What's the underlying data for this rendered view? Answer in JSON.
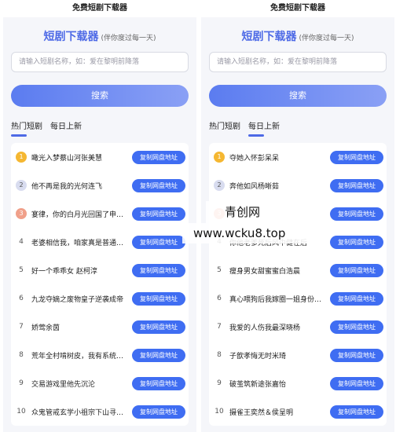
{
  "left": {
    "status_title": "免费短剧下载器",
    "app_name": "短剧下载器",
    "app_sub": "(伴你度过每一天)",
    "search_placeholder": "请输入短剧名称，如：爱在黎明前降落",
    "search_label": "搜索",
    "tabs": [
      "热门短剧",
      "每日上新"
    ],
    "copy_label": "复制网盘地址",
    "items": [
      {
        "rank": "1",
        "title": "瞰光入梦蔡山河张美慧"
      },
      {
        "rank": "2",
        "title": "他不再是我的光何连飞"
      },
      {
        "rank": "3",
        "title": "宴律，你的白月光回国了申浩..."
      },
      {
        "rank": "4",
        "title": "老婆相信我，咱家真是普通家庭"
      },
      {
        "rank": "5",
        "title": "好一个乖乖女 赵柯淳"
      },
      {
        "rank": "6",
        "title": "九龙夺嫡之废物皇子逆袭成帝"
      },
      {
        "rank": "7",
        "title": "娇莺余茵"
      },
      {
        "rank": "8",
        "title": "荒年全村啃树皮，我有系统满..."
      },
      {
        "rank": "9",
        "title": "交易游戏里他先沉沦"
      },
      {
        "rank": "10",
        "title": "众鬼管戒玄学小祖宗下山寻夫..."
      }
    ]
  },
  "right": {
    "status_title": "免费短剧下载器",
    "app_name": "短剧下载器",
    "app_sub": "(伴你度过每一天)",
    "search_placeholder": "请输入短剧名称，如：爱在黎明前降落",
    "search_label": "搜索",
    "tabs": [
      "热门短剧",
      "每日上新"
    ],
    "copy_label": "复制网盘地址",
    "items": [
      {
        "rank": "1",
        "title": "夺她入怀彭呆呆"
      },
      {
        "rank": "2",
        "title": "奔他如风杨晰茹"
      },
      {
        "rank": "3",
        "title": ""
      },
      {
        "rank": "4",
        "title": "你他老爹死后风中健在后"
      },
      {
        "rank": "5",
        "title": "瘦身男女甜蜜蜜白浩晨"
      },
      {
        "rank": "6",
        "title": "真心喂狗后我嫁圈一姐身份被..."
      },
      {
        "rank": "7",
        "title": "我爱的人伤我最深晓杨"
      },
      {
        "rank": "8",
        "title": "子歆孝悔无时米琦"
      },
      {
        "rank": "9",
        "title": "破茧筑新途张嘉怡"
      },
      {
        "rank": "10",
        "title": "摄雀王奕然＆侯呈明"
      }
    ]
  },
  "watermark": {
    "line1": "青创网",
    "line2": "www.wcku8.top"
  }
}
